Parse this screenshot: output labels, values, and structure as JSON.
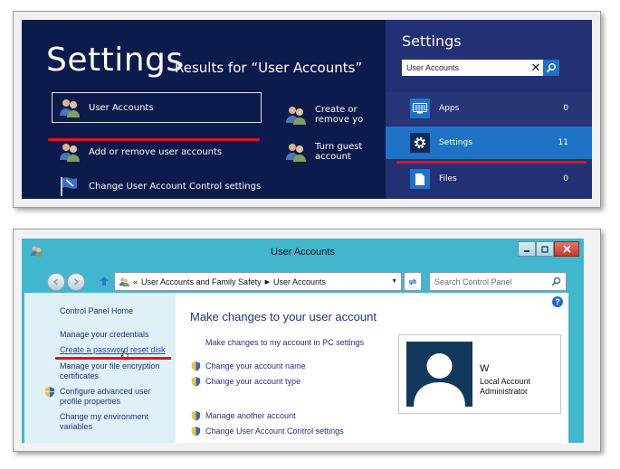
{
  "search_screen": {
    "heading": "Settings",
    "results_for": "Results for “User Accounts”",
    "results": [
      {
        "label": "User Accounts",
        "icon": "users-icon",
        "selected": true
      },
      {
        "label": "Add or remove user accounts",
        "icon": "users-icon",
        "selected": false
      },
      {
        "label": "Change User Account Control settings",
        "icon": "uac-flag-icon",
        "selected": false
      },
      {
        "label": "Create or remove yo",
        "icon": "users-icon",
        "selected": false
      },
      {
        "label": "Turn guest account",
        "icon": "users-icon",
        "selected": false
      }
    ],
    "charm": {
      "title": "Settings",
      "search_value": "User Accounts",
      "categories": [
        {
          "label": "Apps",
          "count": "0",
          "icon": "apps-icon",
          "active": false
        },
        {
          "label": "Settings",
          "count": "11",
          "icon": "gear-icon",
          "active": true
        },
        {
          "label": "Files",
          "count": "0",
          "icon": "file-icon",
          "active": false
        }
      ]
    }
  },
  "control_panel": {
    "window_title": "User Accounts",
    "address": {
      "separator": "«",
      "segments": [
        "User Accounts and Family Safety",
        "User Accounts"
      ]
    },
    "search_placeholder": "Search Control Panel",
    "sidebar": {
      "home": "Control Panel Home",
      "items": [
        "Manage your credentials",
        "Create a password reset disk",
        "Manage your file encryption certificates",
        "Configure advanced user profile properties",
        "Change my environment variables"
      ]
    },
    "main": {
      "title": "Make changes to your user account",
      "pc_settings_link": "Make changes to my account in PC settings",
      "tasks": [
        "Change your account name",
        "Change your account type",
        "Manage another account",
        "Change User Account Control settings"
      ]
    },
    "user": {
      "name": "W",
      "type_line1": "Local Account",
      "type_line2": "Administrator"
    }
  },
  "colors": {
    "metro_bg": "#0d1a4c",
    "charm_bg": "#233074",
    "charm_active": "#1e73c7",
    "highlight_red": "#e0141e",
    "window_frame": "#40b7cf",
    "link_blue": "#1e3287"
  }
}
